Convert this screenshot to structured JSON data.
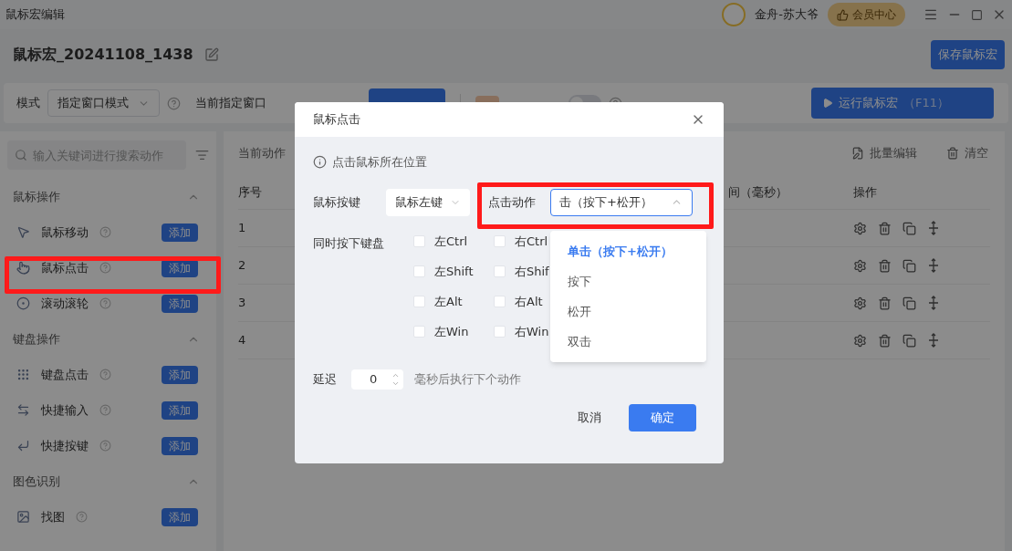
{
  "window": {
    "title": "鼠标宏编辑",
    "user": "金舟-苏大爷",
    "vip_button": "会员中心"
  },
  "macro": {
    "name": "鼠标宏_20241108_1438",
    "save_button": "保存鼠标宏"
  },
  "toolbar": {
    "mode_label": "模式",
    "mode_value": "指定窗口模式",
    "window_label": "当前指定窗口",
    "background_on": false,
    "run_button": "运行鼠标宏",
    "run_shortcut": "（F11）"
  },
  "sidebar": {
    "search": {
      "placeholder": "输入关键词进行搜索动作"
    },
    "groups": [
      {
        "title": "鼠标操作",
        "expanded": true,
        "items": [
          {
            "label": "鼠标移动",
            "kind": "mouse-move",
            "button": "添加"
          },
          {
            "label": "鼠标点击",
            "kind": "mouse-click",
            "button": "添加"
          },
          {
            "label": "滚动滚轮",
            "kind": "scroll",
            "button": "添加"
          }
        ]
      },
      {
        "title": "键盘操作",
        "expanded": true,
        "items": [
          {
            "label": "键盘点击",
            "kind": "keypad",
            "button": "添加"
          },
          {
            "label": "快捷输入",
            "kind": "input",
            "button": "添加"
          },
          {
            "label": "快捷按键",
            "kind": "hotkey",
            "button": "添加"
          }
        ]
      },
      {
        "title": "图色识别",
        "expanded": true,
        "items": [
          {
            "label": "找图",
            "kind": "image",
            "button": "添加"
          }
        ]
      }
    ]
  },
  "actions": {
    "label": "当前动作",
    "batch_edit": "批量编辑",
    "clear": "清空",
    "columns": [
      "序号",
      "间（毫秒）",
      "操作"
    ],
    "rows": [
      "1",
      "2",
      "3",
      "4"
    ]
  },
  "dialog": {
    "title": "鼠标点击",
    "info": "点击鼠标所在位置",
    "button_label": "鼠标按键",
    "button_value": "鼠标左键",
    "action_label": "点击动作",
    "action_value": "击（按下+松开）",
    "action_expanded": true,
    "options": [
      {
        "label": "单击（按下+松开）",
        "selected": true
      },
      {
        "label": "按下",
        "selected": false
      },
      {
        "label": "松开",
        "selected": false
      },
      {
        "label": "双击",
        "selected": false
      }
    ],
    "keys_label": "同时按下键盘",
    "keys": [
      {
        "label": "左Ctrl",
        "checked": false
      },
      {
        "label": "右Ctrl",
        "checked": false
      },
      {
        "label": "左Shift",
        "checked": false
      },
      {
        "label": "右Shif",
        "checked": false
      },
      {
        "label": "左Alt",
        "checked": false
      },
      {
        "label": "右Alt",
        "checked": false
      },
      {
        "label": "左Win",
        "checked": false
      },
      {
        "label": "右Win",
        "checked": false
      }
    ],
    "delay_label": "延迟",
    "delay_value": "0",
    "delay_suffix": "毫秒后执行下个动作",
    "cancel": "取消",
    "ok": "确定"
  }
}
